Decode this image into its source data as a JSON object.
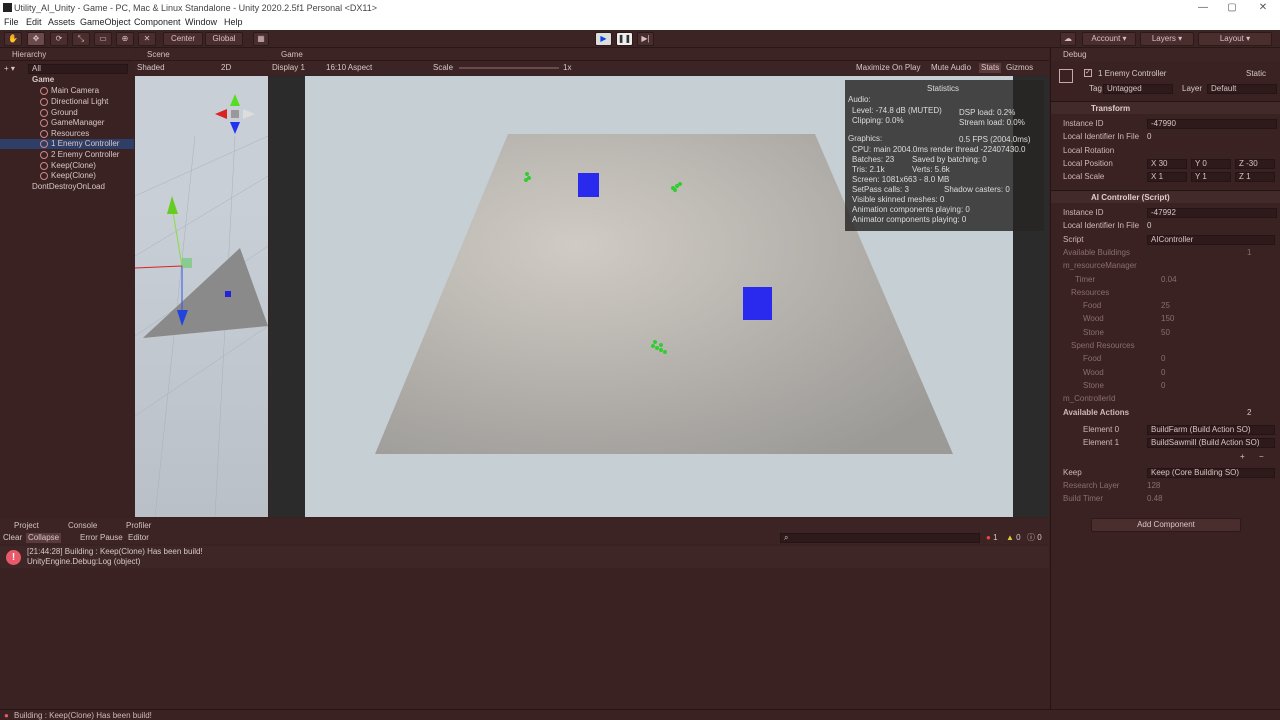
{
  "window": {
    "title": "Utility_AI_Unity - Game - PC, Mac & Linux Standalone - Unity 2020.2.5f1 Personal <DX11>",
    "minimize": "—",
    "maximize": "▢",
    "close": "✕"
  },
  "menu": [
    "File",
    "Edit",
    "Assets",
    "GameObject",
    "Component",
    "Window",
    "Help"
  ],
  "toolbar": {
    "center": "Center",
    "global": "Global",
    "account": "Account",
    "layers": "Layers",
    "layout": "Layout"
  },
  "hierarchy": {
    "tab": "Hierarchy",
    "search_hint": "All",
    "items": [
      "Game",
      "Main Camera",
      "Directional Light",
      "Ground",
      "GameManager",
      "Resources",
      "1 Enemy Controller",
      "2 Enemy Controller",
      "Keep(Clone)",
      "Keep(Clone)",
      "DontDestroyOnLoad"
    ]
  },
  "scene": {
    "tab": "Scene",
    "shading": "Shaded",
    "mode": "2D"
  },
  "game": {
    "tab": "Game",
    "display": "Display 1",
    "aspect": "16:10 Aspect",
    "scale_label": "Scale",
    "scale_value": "1x",
    "maximize": "Maximize On Play",
    "mute": "Mute Audio",
    "stats": "Stats",
    "gizmos": "Gizmos"
  },
  "stats": {
    "title": "Statistics",
    "audio": "Audio:",
    "level": "Level: -74.8 dB (MUTED)",
    "clipping": "Clipping: 0.0%",
    "dsp": "DSP load: 0.2%",
    "stream": "Stream load: 0.0%",
    "graphics": "Graphics:",
    "fps": "0.5 FPS (2004.0ms)",
    "cpu": "CPU: main 2004.0ms  render thread -22407430.0",
    "batches": "Batches: 23",
    "saved": "Saved by batching: 0",
    "tris": "Tris: 2.1k",
    "verts": "Verts: 5.6k",
    "screen": "Screen: 1081x663 - 8.0 MB",
    "setpass": "SetPass calls: 3",
    "shadow": "Shadow casters: 0",
    "skinned": "Visible skinned meshes: 0",
    "anim": "Animation components playing: 0",
    "animator": "Animator components playing: 0"
  },
  "console": {
    "tabs": [
      "Project",
      "Console",
      "Profiler"
    ],
    "clear": "Clear",
    "collapse": "Collapse",
    "error_pause": "Error Pause",
    "editor": "Editor",
    "count_err": "1",
    "count_warn": "0",
    "count_info": "0",
    "msg1": "[21:44:28] Building : Keep(Clone) Has been build!",
    "msg2": "UnityEngine.Debug:Log (object)"
  },
  "inspector": {
    "tab": "Debug",
    "object": "1 Enemy Controller",
    "static": "Static",
    "tag_label": "Tag",
    "tag": "Untagged",
    "layer_label": "Layer",
    "layer": "Default",
    "transform": "Transform",
    "instance_id_label": "Instance ID",
    "instance_id": "-47990",
    "local_id_label": "Local Identifier In File",
    "local_id": "0",
    "local_rotation": "Local Rotation",
    "local_position": "Local Position",
    "pos_x": "30",
    "pos_y": "0",
    "pos_z": "-30",
    "local_scale": "Local Scale",
    "scale_x": "1",
    "scale_y": "1",
    "scale_z": "1",
    "script_section": "AI Controller (Script)",
    "instance_id2": "-47992",
    "local_id2": "0",
    "script_label": "Script",
    "script": "AIController",
    "available_buildings": "Available Buildings",
    "buildings_count": "1",
    "resource_manager": "m_resourceManager",
    "timer": "Timer",
    "timer_val": "0.04",
    "resources": "Resources",
    "food": "Food",
    "food_val": "25",
    "wood": "Wood",
    "wood_val": "150",
    "stone": "Stone",
    "stone_val": "50",
    "spend": "Spend Resources",
    "food2": "0",
    "wood2": "0",
    "stone2": "0",
    "controller_id": "m_ControllerId",
    "available_actions": "Available Actions",
    "actions_count": "2",
    "el0": "Element 0",
    "el0_val": "BuildFarm (Build Action SO)",
    "el1": "Element 1",
    "el1_val": "BuildSawmill (Build Action SO)",
    "keep_label": "Keep",
    "keep_val": "Keep (Core Building SO)",
    "research_label": "Research Layer",
    "research_val": "128",
    "build_timer_label": "Build Timer",
    "build_timer_val": "0.48",
    "add_component": "Add Component"
  },
  "status": "Building : Keep(Clone) Has been build!"
}
